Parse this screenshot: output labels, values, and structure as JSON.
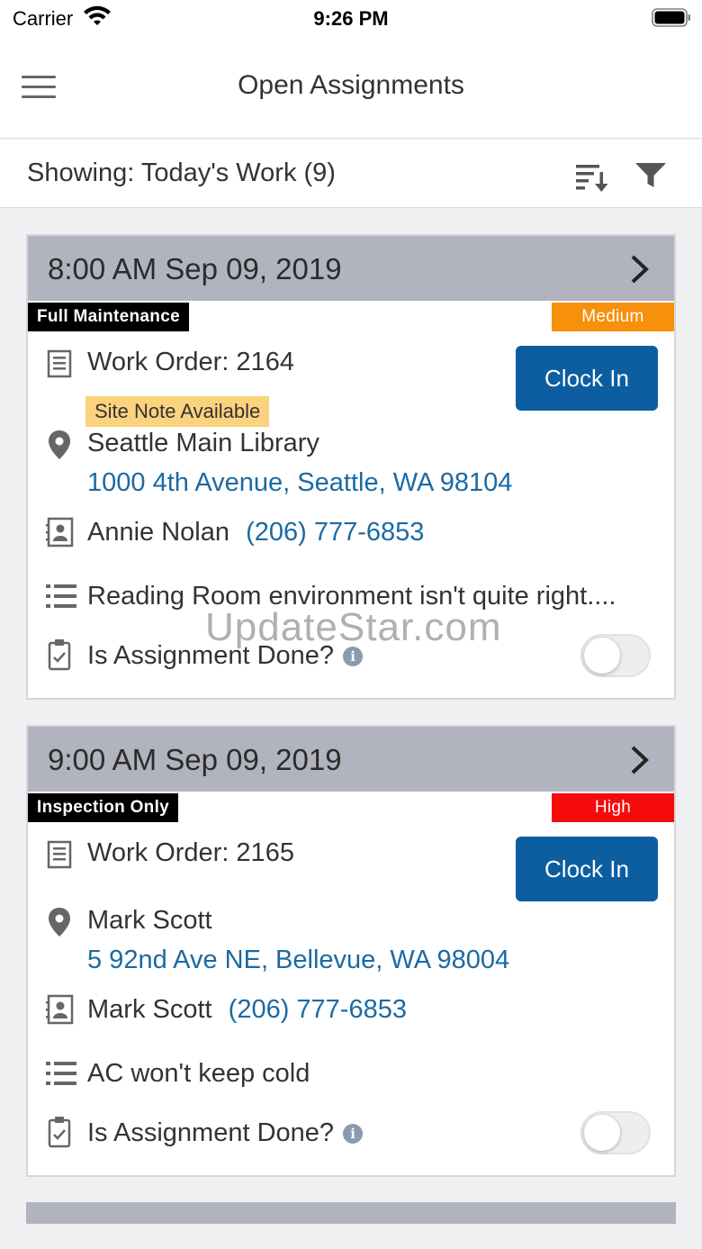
{
  "status_bar": {
    "carrier": "Carrier",
    "time": "9:26 PM"
  },
  "nav": {
    "title": "Open Assignments"
  },
  "filter": {
    "showing": "Showing: Today's Work (9)"
  },
  "assignments": [
    {
      "datetime": "8:00 AM Sep 09, 2019",
      "type": "Full Maintenance",
      "priority": "Medium",
      "priority_color": "#f7900a",
      "work_order": "Work Order: 2164",
      "clock_in": "Clock In",
      "site_note": "Site Note Available",
      "location_name": "Seattle Main Library",
      "address": "1000 4th Avenue, Seattle, WA 98104",
      "contact_name": "Annie Nolan",
      "contact_phone": "(206) 777-6853",
      "description": "Reading Room environment isn't quite right....",
      "done_label": "Is Assignment Done?",
      "done": false
    },
    {
      "datetime": "9:00 AM Sep 09, 2019",
      "type": "Inspection Only",
      "priority": "High",
      "priority_color": "#f70a0a",
      "work_order": "Work Order: 2165",
      "clock_in": "Clock In",
      "location_name": "Mark Scott",
      "address": "5 92nd Ave NE, Bellevue, WA 98004",
      "contact_name": "Mark Scott",
      "contact_phone": "(206) 777-6853",
      "description": "AC won't keep cold",
      "done_label": "Is Assignment Done?",
      "done": false
    }
  ],
  "watermark": "UpdateStar.com"
}
